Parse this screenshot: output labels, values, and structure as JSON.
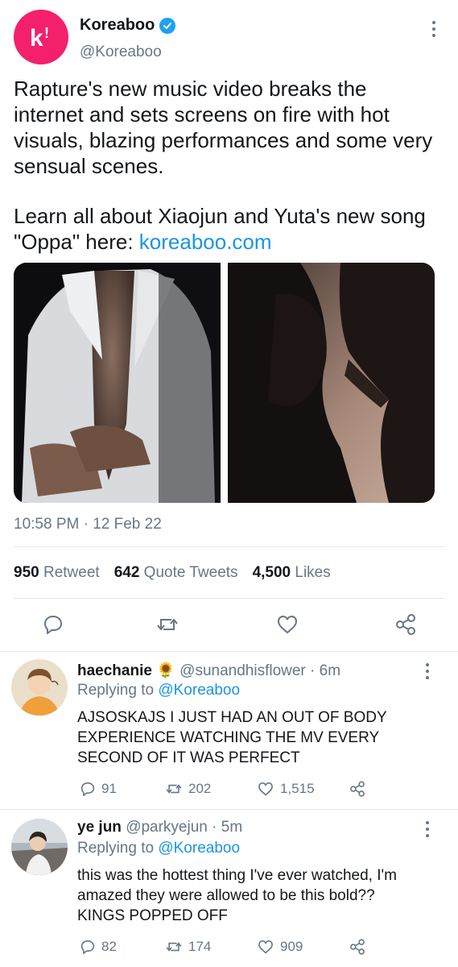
{
  "tweet": {
    "author_name": "Koreaboo",
    "author_handle": "@Koreaboo",
    "paragraph1": "Rapture's new music video breaks the internet and sets screens on fire with hot visuals, blazing performances and some very sensual scenes.",
    "paragraph2_text": "Learn all about Xiaojun and Yuta's new song \"Oppa\" here: ",
    "paragraph2_link": "koreaboo.com",
    "timestamp": "10:58 PM · 12 Feb 22",
    "retweets_count": "950",
    "retweets_label": "Retweet",
    "quotes_count": "642",
    "quotes_label": "Quote Tweets",
    "likes_count": "4,500",
    "likes_label": "Likes"
  },
  "replies": [
    {
      "name": "haechanie",
      "emoji": "🌻",
      "handle": "@sunandhisflower",
      "time": "· 6m",
      "replying_label": "Replying to",
      "replying_to": "@Koreaboo",
      "text": "AJSOSKAJS I JUST HAD AN OUT OF BODY EXPERIENCE WATCHING THE MV EVERY SECOND OF IT WAS PERFECT",
      "replies": "91",
      "retweets": "202",
      "likes": "1,515"
    },
    {
      "name": "ye jun",
      "handle": "@parkyejun",
      "time": "· 5m",
      "replying_label": "Replying to",
      "replying_to": "@Koreaboo",
      "text": "this was the hottest thing I've ever watched, I'm amazed they were allowed to be this bold?? KINGS POPPED OFF",
      "replies": "82",
      "retweets": "174",
      "likes": "909"
    }
  ],
  "colors": {
    "brand_pink": "#f4206c",
    "link_blue": "#1b95e0",
    "muted_gray": "#657786"
  }
}
